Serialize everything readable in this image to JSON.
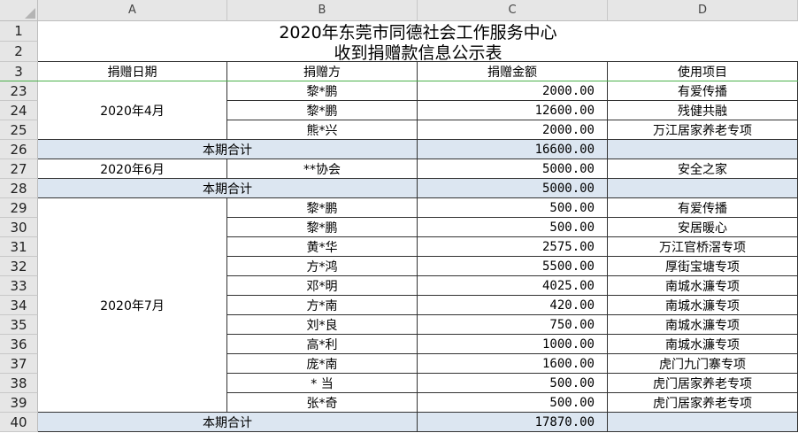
{
  "columns": [
    "A",
    "B",
    "C",
    "D"
  ],
  "title_line1": "2020年东莞市同德社会工作服务中心",
  "title_line2": "收到捐赠款信息公示表",
  "header": {
    "row_number": "3",
    "date": "捐赠日期",
    "donor": "捐赠方",
    "amount": "捐赠金额",
    "usage": "使用项目"
  },
  "title_rows": [
    "1",
    "2"
  ],
  "rows": [
    {
      "n": "23",
      "donor": "黎*鹏",
      "amount": "2000.00",
      "usage": "有爱传播"
    },
    {
      "n": "24",
      "donor": "黎*鹏",
      "amount": "12600.00",
      "usage": "残健共融"
    },
    {
      "n": "25",
      "donor": "熊*兴",
      "amount": "2000.00",
      "usage": "万江居家养老专项"
    },
    {
      "n": "26",
      "subtotal": "本期合计",
      "amount": "16600.00"
    },
    {
      "n": "27",
      "date": "2020年6月",
      "donor": "**协会",
      "amount": "5000.00",
      "usage": "安全之家"
    },
    {
      "n": "28",
      "subtotal": "本期合计",
      "amount": "5000.00"
    },
    {
      "n": "29",
      "donor": "黎*鹏",
      "amount": "500.00",
      "usage": "有爱传播"
    },
    {
      "n": "30",
      "donor": "黎*鹏",
      "amount": "500.00",
      "usage": "安居暖心"
    },
    {
      "n": "31",
      "donor": "黄*华",
      "amount": "2575.00",
      "usage": "万江官桥滘专项"
    },
    {
      "n": "32",
      "donor": "方*鸿",
      "amount": "5500.00",
      "usage": "厚街宝塘专项"
    },
    {
      "n": "33",
      "donor": "邓*明",
      "amount": "4025.00",
      "usage": "南城水濂专项"
    },
    {
      "n": "34",
      "donor": "方*南",
      "amount": "420.00",
      "usage": "南城水濂专项"
    },
    {
      "n": "35",
      "donor": "刘*良",
      "amount": "750.00",
      "usage": "南城水濂专项"
    },
    {
      "n": "36",
      "donor": "高*利",
      "amount": "1000.00",
      "usage": "南城水濂专项"
    },
    {
      "n": "37",
      "donor": "庞*南",
      "amount": "1600.00",
      "usage": "虎门九门寨专项"
    },
    {
      "n": "38",
      "donor": "*  当",
      "amount": "500.00",
      "usage": "虎门居家养老专项"
    },
    {
      "n": "39",
      "donor": "张*奇",
      "amount": "500.00",
      "usage": "虎门居家养老专项"
    },
    {
      "n": "40",
      "subtotal": "本期合计",
      "amount": "17870.00"
    }
  ],
  "merged_dates": [
    {
      "label": "2020年4月",
      "from": 0,
      "to": 2
    },
    {
      "label": "2020年7月",
      "from": 6,
      "to": 16
    }
  ]
}
